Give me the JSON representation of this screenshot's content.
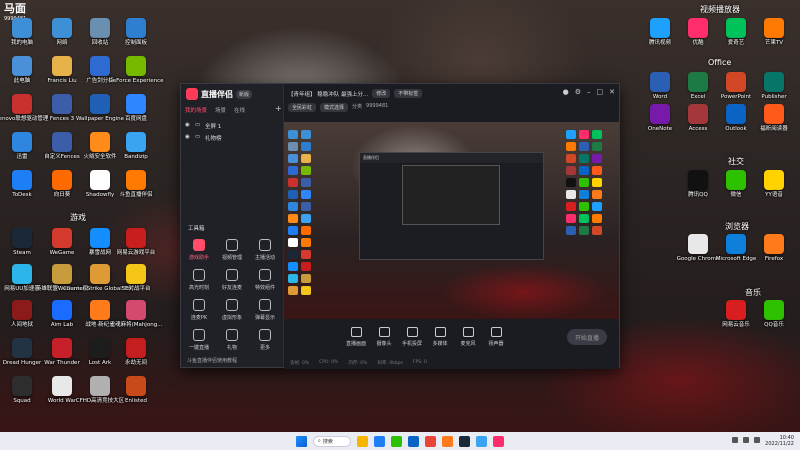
{
  "corner_logo": {
    "text": "马面",
    "sub": "9999481"
  },
  "desktop": {
    "groups": [
      {
        "title": "游戏"
      },
      {
        "title": "视频播放器"
      },
      {
        "title": "Office"
      },
      {
        "title": "社交"
      },
      {
        "title": "浏览器"
      },
      {
        "title": "音乐"
      }
    ],
    "left_icons": [
      {
        "label": "我的电脑",
        "color": "#3d8fd6"
      },
      {
        "label": "网络",
        "color": "#3d8fd6"
      },
      {
        "label": "回收站",
        "color": "#6a8fb0"
      },
      {
        "label": "控制面板",
        "color": "#2e7fd0"
      },
      {
        "label": "此电脑",
        "color": "#4a90d9"
      },
      {
        "label": "Francis Liu",
        "color": "#e8b24a"
      },
      {
        "label": "广告剑分析",
        "color": "#2d6bd3"
      },
      {
        "label": "GeForce Experience",
        "color": "#76b900"
      },
      {
        "label": "Lenovo联想驱动管理",
        "color": "#c8312e"
      },
      {
        "label": "Fences 3",
        "color": "#3c5ea8"
      },
      {
        "label": "Wallpaper Engine",
        "color": "#1f5fb4"
      },
      {
        "label": "百度网盘",
        "color": "#2f86ff"
      },
      {
        "label": "迅雷",
        "color": "#2e86de"
      },
      {
        "label": "自定义Fences",
        "color": "#3c5ea8"
      },
      {
        "label": "火绒安全软件",
        "color": "#ff8c1a"
      },
      {
        "label": "Bandizip",
        "color": "#3aa3f2"
      },
      {
        "label": "ToDesk",
        "color": "#1e7ef5"
      },
      {
        "label": "向日葵",
        "color": "#ff6a00"
      },
      {
        "label": "Shadowfly",
        "color": "#ffffff"
      },
      {
        "label": "斗鱼直播伴侣",
        "color": "#ff7a00"
      },
      {
        "label": "Steam",
        "color": "#1b2838"
      },
      {
        "label": "WeGame",
        "color": "#d43a2e"
      },
      {
        "label": "暴雪战网",
        "color": "#148eff"
      },
      {
        "label": "网易云游戏平台",
        "color": "#c81e1e"
      },
      {
        "label": "网易UU加速器",
        "color": "#2bb5e8"
      },
      {
        "label": "英雄联盟WeGame版",
        "color": "#c89b3c"
      },
      {
        "label": "Counter-Strike Global Off...",
        "color": "#de9b35"
      },
      {
        "label": "5E对战平台",
        "color": "#f5c518"
      },
      {
        "label": "人间地狱",
        "color": "#8b1a1a"
      },
      {
        "label": "Aim Lab",
        "color": "#1a6bff"
      },
      {
        "label": "战地·新纪元",
        "color": "#ff7a1a"
      },
      {
        "label": "雀魂麻将(Mahjong...",
        "color": "#d44a6e"
      },
      {
        "label": "Dread Hunger",
        "color": "#223344"
      },
      {
        "label": "War Thunder",
        "color": "#c8202a"
      },
      {
        "label": "Lost Ark",
        "color": "#1d1d1d"
      },
      {
        "label": "永劫无间",
        "color": "#c41e1e"
      },
      {
        "label": "Squad",
        "color": "#2d2d2d"
      },
      {
        "label": "World War",
        "color": "#e8e8e8"
      },
      {
        "label": "CFHD高清竞技大区",
        "color": "#b0b0b0"
      },
      {
        "label": "Enlisted",
        "color": "#c84a1a"
      }
    ],
    "right_icons": [
      {
        "label": "腾讯视频",
        "color": "#1ea0ff"
      },
      {
        "label": "优酷",
        "color": "#ff2d6b"
      },
      {
        "label": "爱奇艺",
        "color": "#00c25a"
      },
      {
        "label": "芒果TV",
        "color": "#ff7a00"
      },
      {
        "label": "Word",
        "color": "#2b5fb4"
      },
      {
        "label": "Excel",
        "color": "#1d7a45"
      },
      {
        "label": "PowerPoint",
        "color": "#d24726"
      },
      {
        "label": "Publisher",
        "color": "#077568"
      },
      {
        "label": "OneNote",
        "color": "#7719aa"
      },
      {
        "label": "Access",
        "color": "#a4373a"
      },
      {
        "label": "Outlook",
        "color": "#0a64c6"
      },
      {
        "label": "福昕阅读器",
        "color": "#ff5a1a"
      },
      {
        "label": "腾讯QQ",
        "color": "#111111"
      },
      {
        "label": "微信",
        "color": "#2dc100"
      },
      {
        "label": "YY语音",
        "color": "#ffd200"
      },
      {
        "label": "Google Chrome",
        "color": "#e8e8e8"
      },
      {
        "label": "Microsoft Edge",
        "color": "#0f7fdc"
      },
      {
        "label": "Firefox",
        "color": "#ff7a1a"
      },
      {
        "label": "网易云音乐",
        "color": "#d81e1e"
      },
      {
        "label": "QQ音乐",
        "color": "#2dc100"
      }
    ]
  },
  "app_window": {
    "brand": "直播伴侣",
    "version": "新版",
    "tabs": [
      "我的场景",
      "场景",
      "在线"
    ],
    "scenes": [
      {
        "label": "全屏 1"
      },
      {
        "label": "礼物榜"
      }
    ],
    "toolbox_title": "工具箱",
    "tools": [
      {
        "label": "游戏助手"
      },
      {
        "label": "视频管理"
      },
      {
        "label": "主播活动"
      },
      {
        "label": "高光时刻"
      },
      {
        "label": "好友连麦"
      },
      {
        "label": "特效组件"
      },
      {
        "label": "连麦PK"
      },
      {
        "label": "虚拟形象"
      },
      {
        "label": "弹幕显示"
      },
      {
        "label": "一键直播"
      },
      {
        "label": "礼物"
      },
      {
        "label": "更多"
      }
    ],
    "bottom_left_link": "斗鱼直播伴侣使用教程",
    "stream_title": "【青年组】 稳稳冲队 最强上分...",
    "title_pill_1": "修改",
    "title_pill_2": "不带标签",
    "sub_items": [
      "全民彩虹",
      "模式选择",
      "分类",
      "9999481"
    ],
    "bottom_tools": [
      {
        "label": "直播画面"
      },
      {
        "label": "摄像头"
      },
      {
        "label": "手机投屏"
      },
      {
        "label": "多媒体"
      },
      {
        "label": "麦克风"
      },
      {
        "label": "扬声器"
      }
    ],
    "go_live": "开始直播",
    "status": [
      "丢帧: 0%",
      "CPU: 0%",
      "内存: 0%",
      "码率: 0kbps",
      "FPS: 0"
    ]
  },
  "taskbar": {
    "search_placeholder": "搜索",
    "time": "10:40",
    "date": "2022/11/22",
    "apps": [
      "#f7b500",
      "#1e7ef5",
      "#2dc100",
      "#0a64c6",
      "#e8443a",
      "#ff7a1a",
      "#1b2838",
      "#3aa3f2",
      "#ff2d6b"
    ]
  }
}
